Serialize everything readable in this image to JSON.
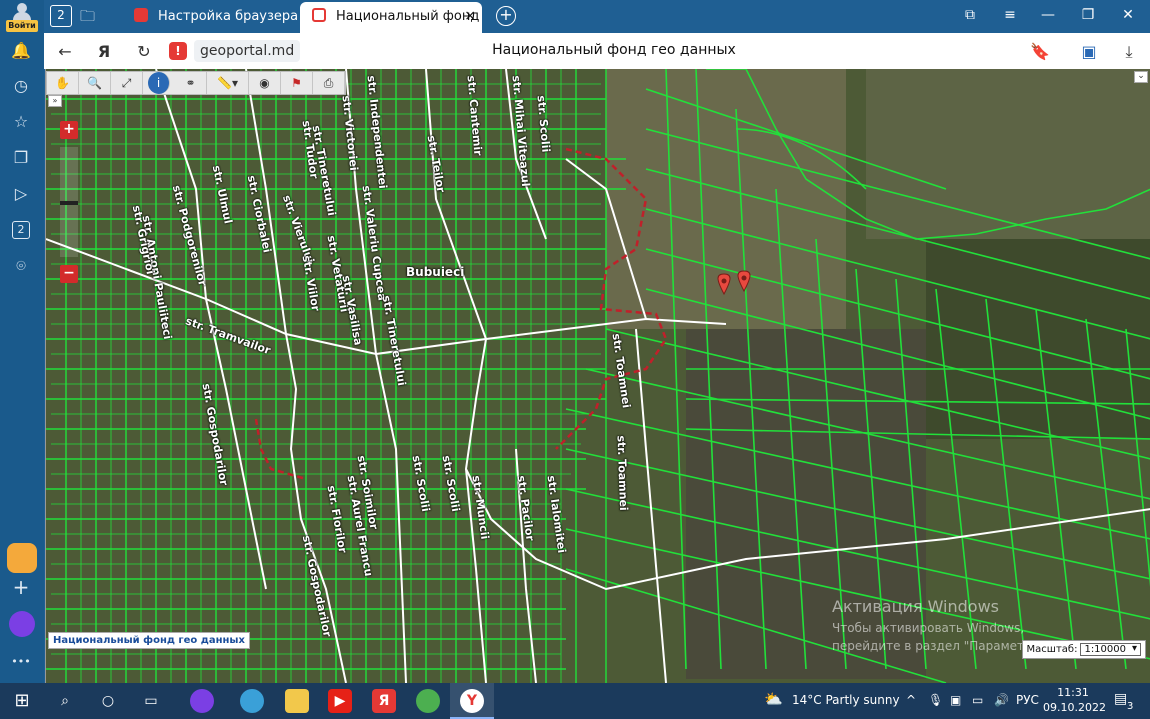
{
  "sidebar": {
    "login_label": "Войти",
    "items": [
      {
        "icon": "bell-icon",
        "glyph": "🔔"
      },
      {
        "icon": "history-icon",
        "glyph": "◷"
      },
      {
        "icon": "star-icon",
        "glyph": "☆"
      },
      {
        "icon": "collections-icon",
        "glyph": "❐"
      },
      {
        "icon": "play-icon",
        "glyph": "▷"
      },
      {
        "icon": "counter-icon",
        "glyph": "2"
      },
      {
        "icon": "camera-icon",
        "glyph": "⌾"
      }
    ],
    "more_label": "•••"
  },
  "tabs": {
    "counter": "2",
    "items": [
      {
        "label": "Настройка браузера",
        "favicon_color": "#e53935",
        "active": false
      },
      {
        "label": "Национальный фонд ге",
        "favicon_color": "#e53935",
        "active": true
      }
    ],
    "close_glyph": "×",
    "add_glyph": "+"
  },
  "address": {
    "domain": "geoportal.md",
    "title": "Национальный фонд гео данных"
  },
  "map": {
    "toolbar_icons": [
      "pan-hand-icon",
      "zoom-box-icon",
      "extent-icon",
      "info-icon",
      "binoculars-icon",
      "measure-icon",
      "target-icon",
      "flag-icon",
      "print-icon"
    ],
    "zoom_in": "+",
    "zoom_out": "−",
    "place_label": "Bubuieci",
    "streets": [
      {
        "text": "str. Podgorenilor"
      },
      {
        "text": "str. Antoni Pauliiteci"
      },
      {
        "text": "str. Grigrioi"
      },
      {
        "text": "str. Ulmul"
      },
      {
        "text": "str. Ciorbalei"
      },
      {
        "text": "str. Vierului"
      },
      {
        "text": "str. Tineretului"
      },
      {
        "text": "str. Independentei"
      },
      {
        "text": "str. Victoriei"
      },
      {
        "text": "str. Cantemir"
      },
      {
        "text": "str. Mihai Viteazul"
      },
      {
        "text": "str. Tudor"
      },
      {
        "text": "str. Scolii"
      },
      {
        "text": "str. Valeriu Cupcea"
      },
      {
        "text": "str. Teilor"
      },
      {
        "text": "str. Vetaturii"
      },
      {
        "text": "str. Viilor"
      },
      {
        "text": "str. Vasilisa"
      },
      {
        "text": "str. Tineretului"
      },
      {
        "text": "str. Toamnei"
      },
      {
        "text": "str. Toamnei"
      },
      {
        "text": "str. Gospodarilor"
      },
      {
        "text": "str. Gospodarilor"
      },
      {
        "text": "str. Scolii"
      },
      {
        "text": "str. Scolii"
      },
      {
        "text": "str. Soimilor"
      },
      {
        "text": "str. Florilor"
      },
      {
        "text": "str. Muncii"
      },
      {
        "text": "str. Pacilor"
      },
      {
        "text": "str. Ialomitei"
      },
      {
        "text": "str. Aurel Francu"
      },
      {
        "text": "str. Tramvailor"
      }
    ],
    "footer_label": "Национальный фонд гео данных",
    "scale_label": "Масштаб:",
    "scale_value": "1:10000",
    "watermark_title": "Активация Windows",
    "watermark_text": "Чтобы активировать Windows, перейдите в раздел \"Параметры\"."
  },
  "taskbar": {
    "weather": "14°C  Partly sunny",
    "lang": "РУС",
    "time": "11:31",
    "date": "09.10.2022",
    "notif_count": "3"
  },
  "colors": {
    "parcel": "#22e03a",
    "road": "#ffffff",
    "boundary": "#c0202a",
    "marker": "#e8493f"
  }
}
